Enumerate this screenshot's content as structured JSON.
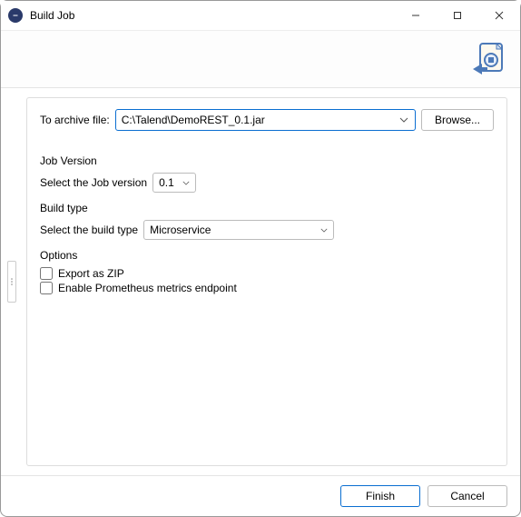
{
  "titlebar": {
    "title": "Build Job"
  },
  "archive": {
    "label": "To archive file:",
    "value": "C:\\Talend\\DemoREST_0.1.jar",
    "browse": "Browse..."
  },
  "job_version": {
    "group_title": "Job Version",
    "label": "Select the Job version",
    "value": "0.1"
  },
  "build_type": {
    "group_title": "Build type",
    "label": "Select the build type",
    "value": "Microservice"
  },
  "options": {
    "group_title": "Options",
    "export_zip": "Export as ZIP",
    "prometheus": "Enable Prometheus metrics endpoint"
  },
  "buttons": {
    "finish": "Finish",
    "cancel": "Cancel"
  }
}
